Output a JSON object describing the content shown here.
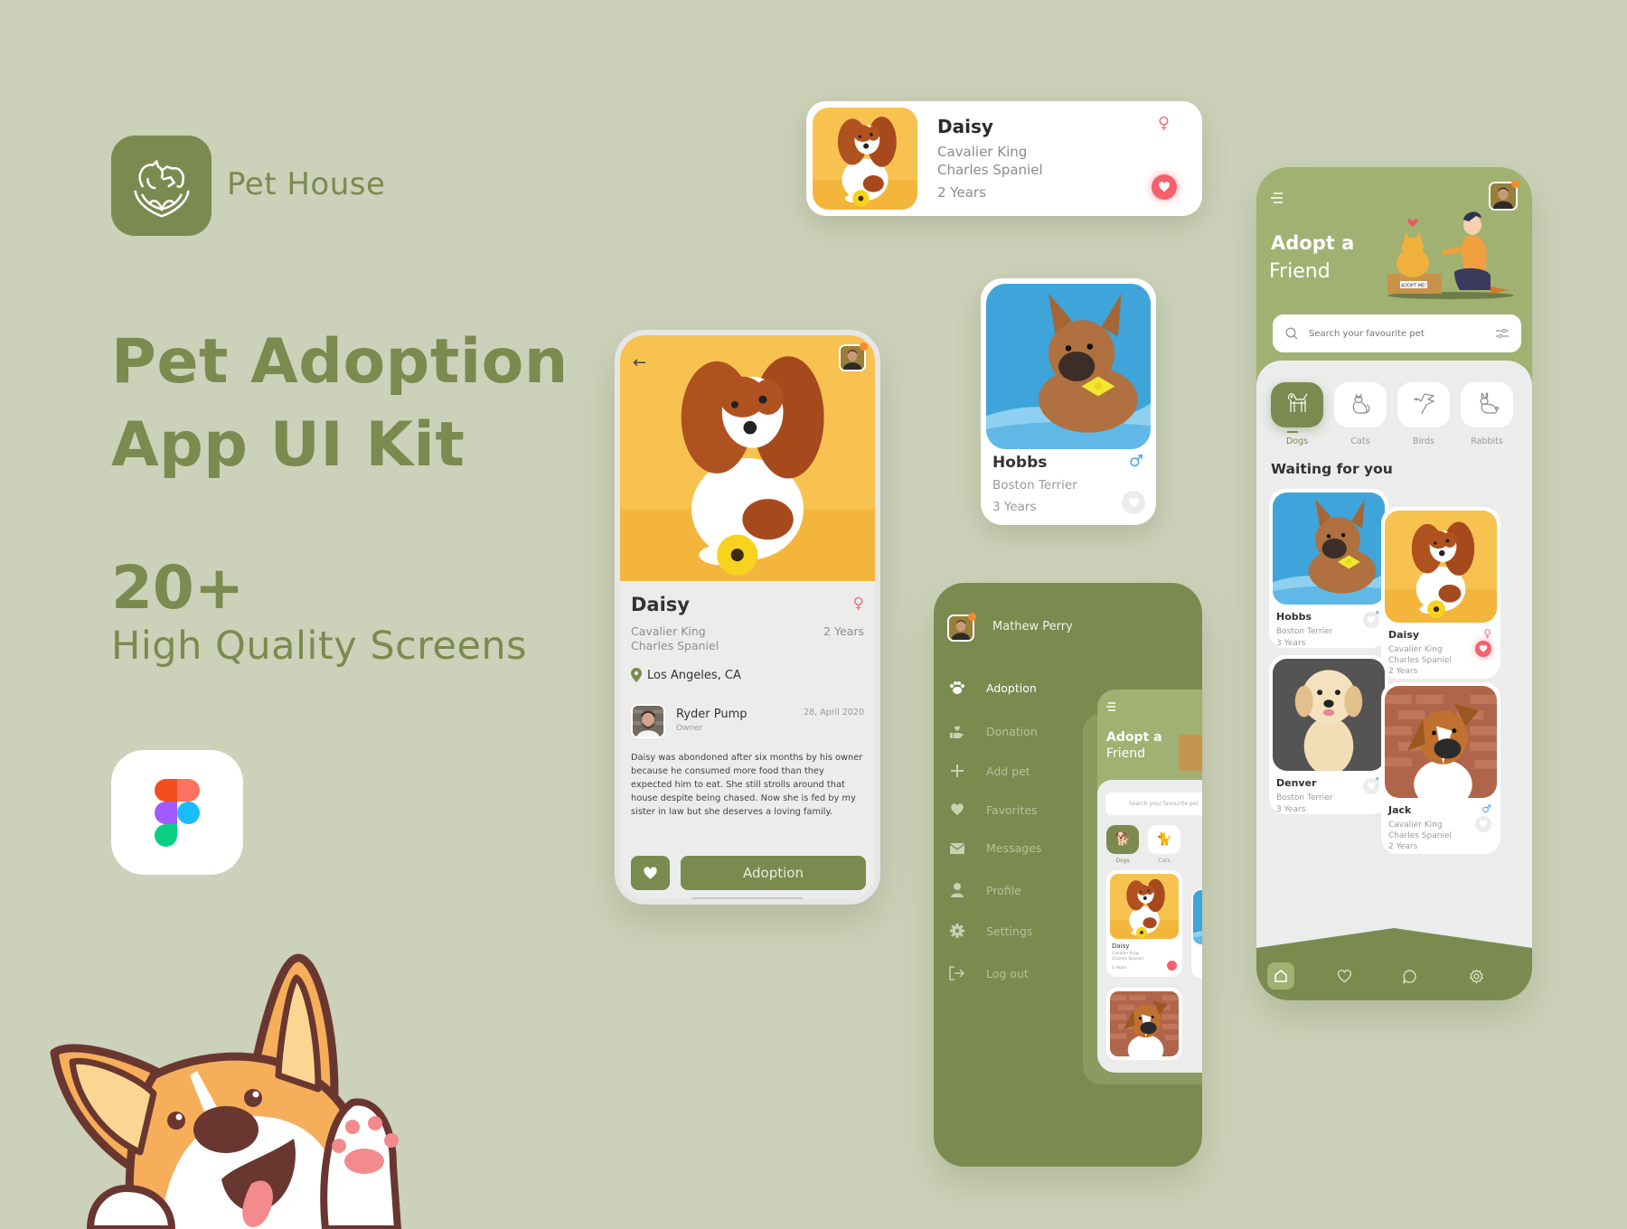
{
  "brand": {
    "name": "Pet House",
    "headline_line1": "Pet Adoption",
    "headline_line2": "App UI Kit",
    "count": "20+",
    "count_caption": "High Quality Screens",
    "tool_icon": "figma-logo-icon",
    "mascot": "corgi-waving-illustration"
  },
  "colors": {
    "background": "#ccd1b9",
    "primary": "#7b8a4f",
    "primary_light": "#a0b172",
    "surface": "#ececec",
    "favorite": "#f75f6b",
    "female": "#f2737a",
    "male": "#4aa3df",
    "notification_dot": "#f28a2e"
  },
  "top_card": {
    "name": "Daisy",
    "breed_line1": "Cavalier King",
    "breed_line2": "Charles Spaniel",
    "age": "2 Years",
    "gender": "female",
    "gender_symbol": "♀",
    "favorited": true
  },
  "hobbs_card": {
    "name": "Hobbs",
    "breed": "Boston Terrier",
    "age": "3 Years",
    "gender": "male",
    "gender_symbol": "♂",
    "favorited": false
  },
  "detail_screen": {
    "pet_name": "Daisy",
    "gender_symbol": "♀",
    "breed_line1": "Cavalier King",
    "breed_line2": "Charles Spaniel",
    "age": "2 Years",
    "location": "Los Angeles, CA",
    "owner_name": "Ryder Pump",
    "owner_role": "Owner",
    "post_date": "28, April 2020",
    "description": "Daisy was abondoned after six months by his owner because he consumed more food than they expected him to eat. She still strolls around that house despite being chased. Now she is fed by my sister in law but she deserves a loving family.",
    "adopt_button": "Adoption",
    "back_icon": "←"
  },
  "menu_screen": {
    "user_name": "Mathew Perry",
    "items": [
      {
        "label": "Adoption",
        "icon": "paw-icon",
        "glyph": "🐾",
        "active": true
      },
      {
        "label": "Donation",
        "icon": "donation-hand-icon",
        "glyph": "❤",
        "active": false
      },
      {
        "label": "Add pet",
        "icon": "plus-icon",
        "glyph": "+",
        "active": false
      },
      {
        "label": "Favorites",
        "icon": "heart-icon",
        "glyph": "♥",
        "active": false
      },
      {
        "label": "Messages",
        "icon": "envelope-icon",
        "glyph": "✉",
        "active": false
      },
      {
        "label": "Profile",
        "icon": "user-icon",
        "glyph": "●",
        "active": false
      },
      {
        "label": "Settings",
        "icon": "gear-icon",
        "glyph": "⚙",
        "active": false
      },
      {
        "label": "Log out",
        "icon": "logout-icon",
        "glyph": "⇥",
        "active": false
      }
    ],
    "preview": {
      "title_line1": "Adopt a",
      "title_line2": "Friend",
      "search_placeholder": "Search your favourite pet",
      "categories": [
        "Dogs",
        "Cats"
      ],
      "card_name": "Daisy",
      "card_breed_line1": "Cavalier King",
      "card_breed_line2": "Charles Spaniel",
      "card_age": "2 Years"
    }
  },
  "home_screen": {
    "title_line1": "Adopt a",
    "title_line2": "Friend",
    "illustration_sign": "ADOPT ME!",
    "search_placeholder": "Search your favourite pet",
    "categories": [
      {
        "label": "Dogs",
        "icon": "dog-icon",
        "active": true
      },
      {
        "label": "Cats",
        "icon": "cat-icon",
        "active": false
      },
      {
        "label": "Birds",
        "icon": "bird-icon",
        "active": false
      },
      {
        "label": "Rabbits",
        "icon": "rabbit-icon",
        "active": false
      }
    ],
    "section_title": "Waiting for you",
    "pets": [
      {
        "name": "Hobbs",
        "breed_line1": "Boston Terrier",
        "breed_line2": "",
        "age": "3 Years",
        "gender_symbol": "♂",
        "gender": "male",
        "favorited": false
      },
      {
        "name": "Daisy",
        "breed_line1": "Cavalier King",
        "breed_line2": "Charles Spaniel",
        "age": "2 Years",
        "gender_symbol": "♀",
        "gender": "female",
        "favorited": true
      },
      {
        "name": "Denver",
        "breed_line1": "Boston Terrier",
        "breed_line2": "",
        "age": "3 Years",
        "gender_symbol": "♂",
        "gender": "male",
        "favorited": false
      },
      {
        "name": "Jack",
        "breed_line1": "Cavalier King",
        "breed_line2": "Charles Spaniel",
        "age": "2 Years",
        "gender_symbol": "♂",
        "gender": "male",
        "favorited": false
      }
    ],
    "nav": [
      {
        "name": "home",
        "icon": "home-icon",
        "active": true
      },
      {
        "name": "favorites",
        "icon": "heart-outline-icon",
        "active": false
      },
      {
        "name": "messages",
        "icon": "chat-bubble-icon",
        "active": false
      },
      {
        "name": "settings",
        "icon": "gear-outline-icon",
        "active": false
      }
    ]
  }
}
